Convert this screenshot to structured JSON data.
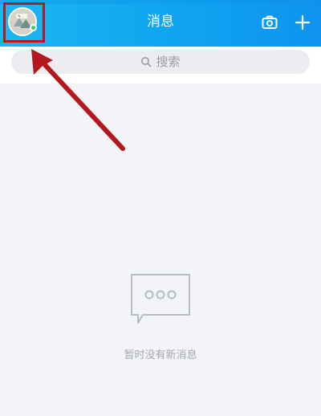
{
  "header": {
    "title": "消息",
    "avatar_icon": "avatar",
    "camera_icon": "camera-icon",
    "plus_icon": "plus-icon"
  },
  "search": {
    "placeholder": "搜索",
    "icon": "search-icon"
  },
  "empty_state": {
    "message": "暂时没有新消息",
    "icon": "message-bubble-icon"
  },
  "annotation": {
    "highlight_color": "#b3191c",
    "arrow_color": "#b3191c"
  }
}
